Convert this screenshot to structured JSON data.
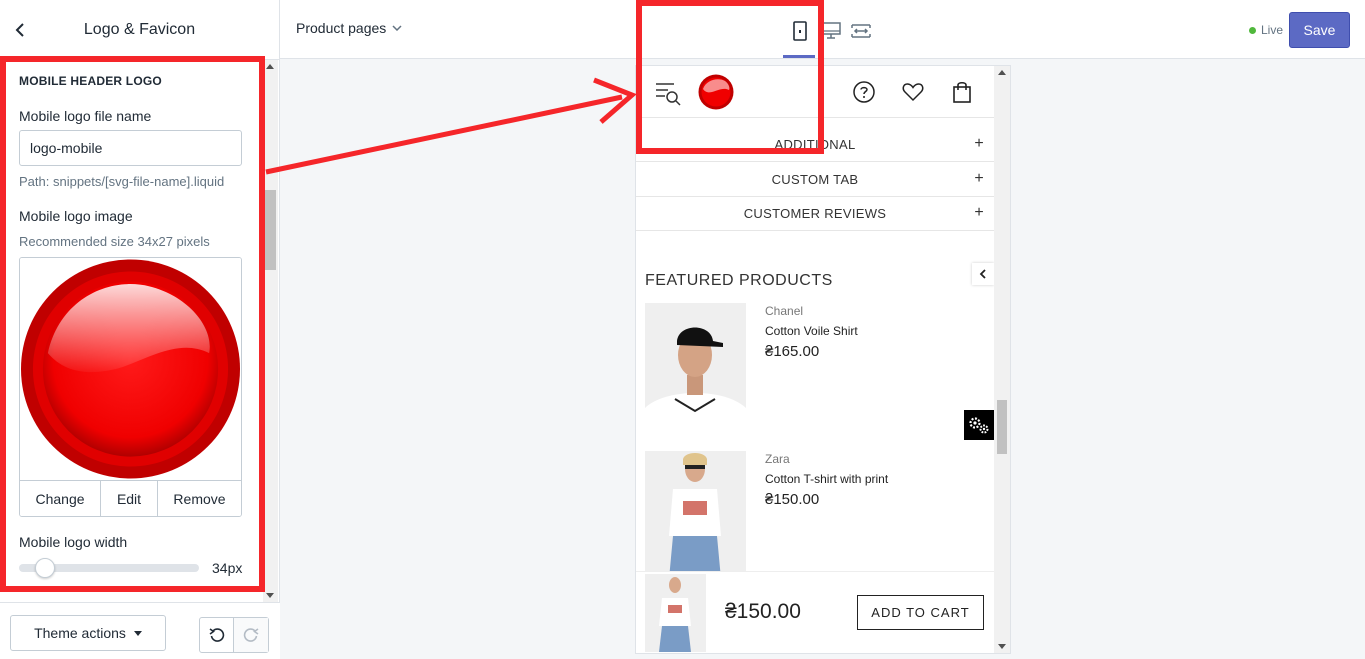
{
  "sidebar": {
    "title": "Logo & Favicon",
    "section_heading": "MOBILE HEADER LOGO",
    "file_name_label": "Mobile logo file name",
    "file_name_value": "logo-mobile",
    "file_path_help": "Path: snippets/[svg-file-name].liquid",
    "image_label": "Mobile logo image",
    "image_help": "Recommended size 34x27 pixels",
    "image_actions": {
      "change": "Change",
      "edit": "Edit",
      "remove": "Remove"
    },
    "width_label": "Mobile logo width",
    "width_value": "34px",
    "width_slider_fraction": 0.1,
    "theme_actions": "Theme actions"
  },
  "topbar": {
    "page_select": "Product pages",
    "live": "Live",
    "save": "Save"
  },
  "preview": {
    "accordions": [
      "ADDITIONAL",
      "CUSTOM TAB",
      "CUSTOMER REVIEWS"
    ],
    "featured_title": "FEATURED PRODUCTS",
    "products": [
      {
        "brand": "Chanel",
        "name": "Cotton Voile Shirt",
        "price": "₴165.00"
      },
      {
        "brand": "Zara",
        "name": "Cotton T-shirt with print",
        "price": "₴150.00"
      }
    ],
    "sticky_price": "₴150.00",
    "add_to_cart": "ADD TO CART"
  },
  "colors": {
    "accent": "#5c6ac4",
    "highlight": "#f5262a",
    "live": "#50b83c",
    "logo_red": "#ff0000"
  }
}
